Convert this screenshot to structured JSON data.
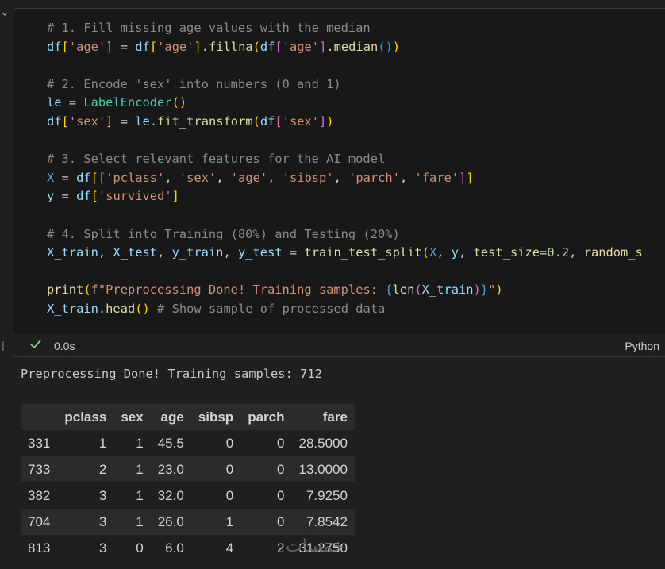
{
  "cell": {
    "code_lines": [
      [
        {
          "t": "# 1. Fill missing age values with the median",
          "c": "cm"
        }
      ],
      [
        {
          "t": "df",
          "c": "var"
        },
        {
          "t": "[",
          "c": "br1"
        },
        {
          "t": "'age'",
          "c": "str"
        },
        {
          "t": "]",
          "c": "br1"
        },
        {
          "t": " = ",
          "c": "pu"
        },
        {
          "t": "df",
          "c": "var"
        },
        {
          "t": "[",
          "c": "br1"
        },
        {
          "t": "'age'",
          "c": "str"
        },
        {
          "t": "]",
          "c": "br1"
        },
        {
          "t": ".",
          "c": "pu"
        },
        {
          "t": "fillna",
          "c": "fn"
        },
        {
          "t": "(",
          "c": "br1"
        },
        {
          "t": "df",
          "c": "var"
        },
        {
          "t": "[",
          "c": "br2"
        },
        {
          "t": "'age'",
          "c": "str"
        },
        {
          "t": "]",
          "c": "br2"
        },
        {
          "t": ".",
          "c": "pu"
        },
        {
          "t": "median",
          "c": "fn"
        },
        {
          "t": "()",
          "c": "br3"
        },
        {
          "t": ")",
          "c": "br1"
        }
      ],
      [],
      [
        {
          "t": "# 2. Encode 'sex' into numbers (0 and 1)",
          "c": "cm"
        }
      ],
      [
        {
          "t": "le",
          "c": "var"
        },
        {
          "t": " = ",
          "c": "pu"
        },
        {
          "t": "LabelEncoder",
          "c": "cls"
        },
        {
          "t": "()",
          "c": "br1"
        }
      ],
      [
        {
          "t": "df",
          "c": "var"
        },
        {
          "t": "[",
          "c": "br1"
        },
        {
          "t": "'sex'",
          "c": "str"
        },
        {
          "t": "]",
          "c": "br1"
        },
        {
          "t": " = ",
          "c": "pu"
        },
        {
          "t": "le",
          "c": "var"
        },
        {
          "t": ".",
          "c": "pu"
        },
        {
          "t": "fit_transform",
          "c": "fn"
        },
        {
          "t": "(",
          "c": "br1"
        },
        {
          "t": "df",
          "c": "var"
        },
        {
          "t": "[",
          "c": "br2"
        },
        {
          "t": "'sex'",
          "c": "str"
        },
        {
          "t": "]",
          "c": "br2"
        },
        {
          "t": ")",
          "c": "br1"
        }
      ],
      [],
      [
        {
          "t": "# 3. Select relevant features for the AI model",
          "c": "cm"
        }
      ],
      [
        {
          "t": "X",
          "c": "kw"
        },
        {
          "t": " = ",
          "c": "pu"
        },
        {
          "t": "df",
          "c": "var"
        },
        {
          "t": "[",
          "c": "br1"
        },
        {
          "t": "[",
          "c": "br2"
        },
        {
          "t": "'pclass'",
          "c": "str"
        },
        {
          "t": ", ",
          "c": "pu"
        },
        {
          "t": "'sex'",
          "c": "str"
        },
        {
          "t": ", ",
          "c": "pu"
        },
        {
          "t": "'age'",
          "c": "str"
        },
        {
          "t": ", ",
          "c": "pu"
        },
        {
          "t": "'sibsp'",
          "c": "str"
        },
        {
          "t": ", ",
          "c": "pu"
        },
        {
          "t": "'parch'",
          "c": "str"
        },
        {
          "t": ", ",
          "c": "pu"
        },
        {
          "t": "'fare'",
          "c": "str"
        },
        {
          "t": "]",
          "c": "br2"
        },
        {
          "t": "]",
          "c": "br1"
        }
      ],
      [
        {
          "t": "y",
          "c": "var"
        },
        {
          "t": " = ",
          "c": "pu"
        },
        {
          "t": "df",
          "c": "var"
        },
        {
          "t": "[",
          "c": "br1"
        },
        {
          "t": "'survived'",
          "c": "str"
        },
        {
          "t": "]",
          "c": "br1"
        }
      ],
      [],
      [
        {
          "t": "# 4. Split into Training (80%) and Testing (20%)",
          "c": "cm"
        }
      ],
      [
        {
          "t": "X_train",
          "c": "var"
        },
        {
          "t": ", ",
          "c": "pu"
        },
        {
          "t": "X_test",
          "c": "var"
        },
        {
          "t": ", ",
          "c": "pu"
        },
        {
          "t": "y_train",
          "c": "var"
        },
        {
          "t": ", ",
          "c": "pu"
        },
        {
          "t": "y_test",
          "c": "var"
        },
        {
          "t": " = ",
          "c": "pu"
        },
        {
          "t": "train_test_split",
          "c": "fn"
        },
        {
          "t": "(",
          "c": "br1"
        },
        {
          "t": "X",
          "c": "kw"
        },
        {
          "t": ", ",
          "c": "pu"
        },
        {
          "t": "y",
          "c": "var"
        },
        {
          "t": ", ",
          "c": "pu"
        },
        {
          "t": "test_size",
          "c": "fn"
        },
        {
          "t": "=",
          "c": "pu"
        },
        {
          "t": "0.2",
          "c": "num"
        },
        {
          "t": ", ",
          "c": "pu"
        },
        {
          "t": "random_s",
          "c": "fn"
        }
      ],
      [],
      [
        {
          "t": "print",
          "c": "fn"
        },
        {
          "t": "(",
          "c": "br1"
        },
        {
          "t": "f\"Preprocessing Done! Training samples: ",
          "c": "str"
        },
        {
          "t": "{",
          "c": "kw"
        },
        {
          "t": "len",
          "c": "fn"
        },
        {
          "t": "(",
          "c": "br2"
        },
        {
          "t": "X_train",
          "c": "var"
        },
        {
          "t": ")",
          "c": "br2"
        },
        {
          "t": "}",
          "c": "kw"
        },
        {
          "t": "\"",
          "c": "str"
        },
        {
          "t": ")",
          "c": "br1"
        }
      ],
      [
        {
          "t": "X_train",
          "c": "var"
        },
        {
          "t": ".",
          "c": "pu"
        },
        {
          "t": "head",
          "c": "fn"
        },
        {
          "t": "()",
          "c": "br1"
        },
        {
          "t": " # Show sample of processed data",
          "c": "cm"
        }
      ]
    ],
    "exec_time": "0.0s",
    "language": "Python",
    "gutter_bracket": "]"
  },
  "output": {
    "stdout": "Preprocessing Done! Training samples: 712",
    "table": {
      "columns": [
        "",
        "pclass",
        "sex",
        "age",
        "sibsp",
        "parch",
        "fare"
      ],
      "rows": [
        [
          "331",
          "1",
          "1",
          "45.5",
          "0",
          "0",
          "28.5000"
        ],
        [
          "733",
          "2",
          "1",
          "23.0",
          "0",
          "0",
          "13.0000"
        ],
        [
          "382",
          "3",
          "1",
          "32.0",
          "0",
          "0",
          "7.9250"
        ],
        [
          "704",
          "3",
          "1",
          "26.0",
          "1",
          "0",
          "7.8542"
        ],
        [
          "813",
          "3",
          "0",
          "6.0",
          "4",
          "2",
          "31.2750"
        ]
      ]
    }
  },
  "watermark": "خمسات",
  "colors": {
    "background": "#1f1f1f",
    "success_check": "#89d185"
  }
}
